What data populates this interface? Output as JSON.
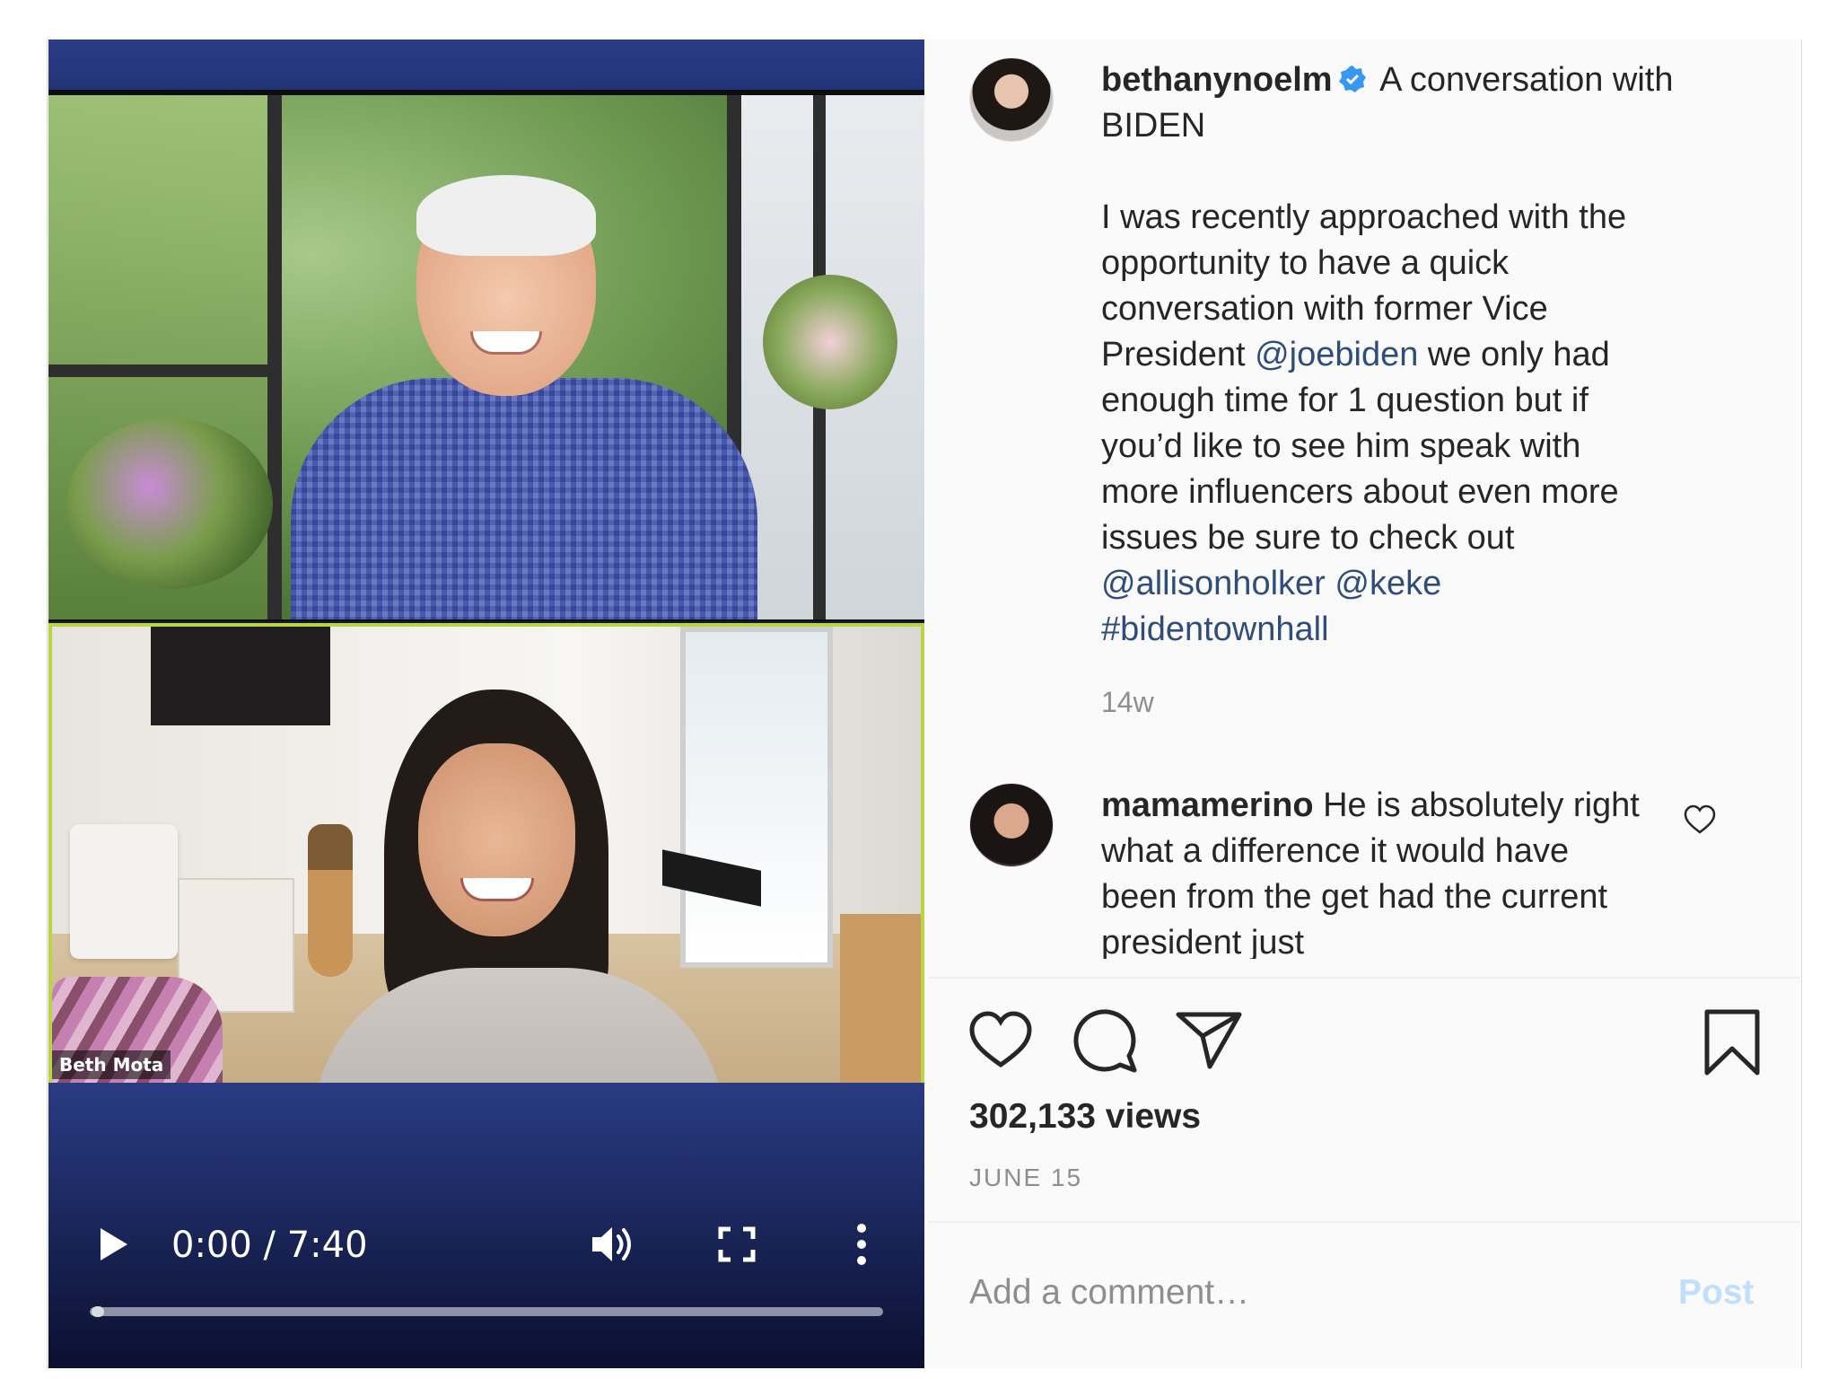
{
  "video": {
    "participant_name": "Beth Mota",
    "time": "0:00 / 7:40",
    "progress": 0.0,
    "icons": {
      "play": "play-icon",
      "volume": "volume-icon",
      "fullscreen": "fullscreen-icon",
      "menu": "more-vertical-icon"
    }
  },
  "post": {
    "username": "bethanynoelm",
    "title": "A conversation with BIDEN",
    "caption_lines": [
      "I was recently approached with the",
      "opportunity to have a quick",
      "conversation with former Vice"
    ],
    "caption_line4_pre": "President ",
    "caption_mention1": "@joebiden",
    "caption_line4_post": " we only had",
    "caption_lines2": [
      "enough time for 1 question but if",
      "you’d like to see him speak with",
      "more influencers about even more",
      "issues be sure to check out"
    ],
    "caption_mention2": "@allisonholker",
    "caption_mention3": "@keke",
    "caption_hashtag": "#bidentownhall",
    "time_ago": "14w"
  },
  "comment": {
    "username": "mamamerino",
    "text": "He is absolutely right what a difference it would have been from the get had the current president just"
  },
  "actions": {
    "views": "302,133 views",
    "date": "JUNE 15"
  },
  "composer": {
    "placeholder": "Add a comment…",
    "post_label": "Post"
  },
  "colors": {
    "verified": "#3897f0",
    "mention": "#2f4d7a",
    "post_disabled": "#c0dffd",
    "video_bg": "#1c285e"
  }
}
